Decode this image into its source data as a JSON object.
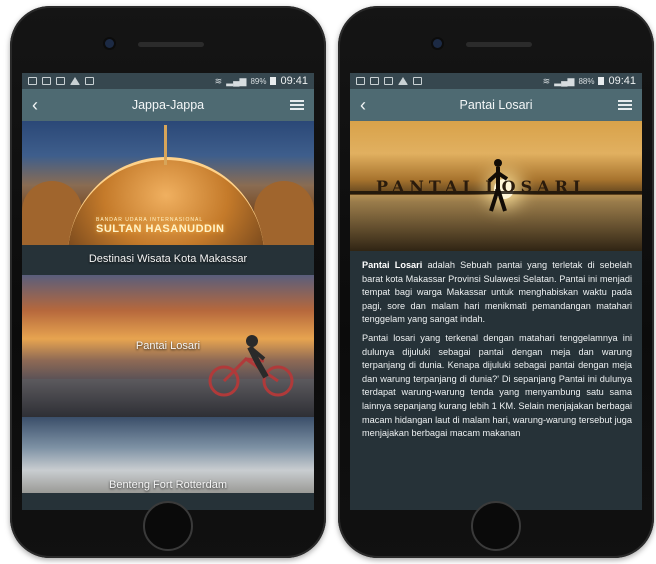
{
  "left_phone": {
    "status": {
      "battery": "89%",
      "time": "09:41"
    },
    "appbar": {
      "title": "Jappa-Jappa"
    },
    "cards": [
      {
        "sign_top": "BANDAR UDARA INTERNASIONAL",
        "sign_main": "SULTAN HASANUDDIN",
        "caption": "Destinasi Wisata Kota Makassar"
      },
      {
        "caption": "Pantai Losari"
      },
      {
        "caption": "Benteng Fort Rotterdam"
      }
    ]
  },
  "right_phone": {
    "status": {
      "battery": "88%",
      "time": "09:41"
    },
    "appbar": {
      "title": "Pantai Losari"
    },
    "hero_lettering": "PANTAI LOSARI",
    "article": {
      "p1_bold": "Pantai Losari",
      "p1_rest": " adalah Sebuah pantai yang terletak di sebelah barat kota Makassar Provinsi Sulawesi Selatan. Pantai ini menjadi tempat bagi warga Makassar untuk menghabiskan waktu pada pagi, sore dan malam hari menikmati pemandangan matahari tenggelam yang sangat indah.",
      "p2": "Pantai losari yang terkenal dengan matahari tenggelamnya ini dulunya dijuluki sebagai pantai dengan meja dan warung terpanjang di dunia. Kenapa dijuluki sebagai pantai dengan meja dan warung terpanjang di dunia?' Di sepanjang Pantai ini dulunya terdapat warung-warung tenda yang menyambung satu sama lainnya sepanjang kurang lebih 1 KM. Selain menjajakan berbagai macam hidangan laut di malam hari, warung-warung tersebut juga menjajakan berbagai macam makanan"
    }
  }
}
